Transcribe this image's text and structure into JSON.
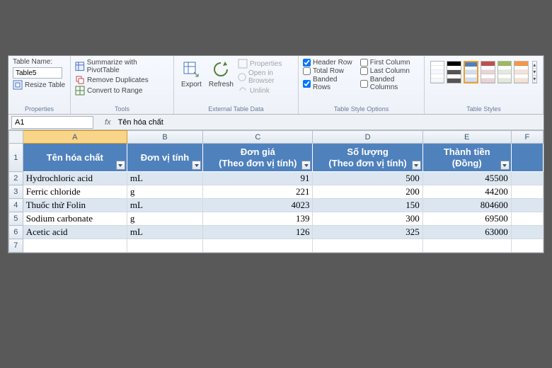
{
  "ribbon": {
    "properties": {
      "table_name_label": "Table Name:",
      "table_name_value": "Table5",
      "resize_label": "Resize Table",
      "group_label": "Properties"
    },
    "tools": {
      "summarize": "Summarize with PivotTable",
      "remove_dup": "Remove Duplicates",
      "convert": "Convert to Range",
      "group_label": "Tools"
    },
    "external": {
      "export": "Export",
      "refresh": "Refresh",
      "props": "Properties",
      "open_browser": "Open in Browser",
      "unlink": "Unlink",
      "group_label": "External Table Data"
    },
    "style_opts": {
      "header_row": "Header Row",
      "total_row": "Total Row",
      "banded_rows": "Banded Rows",
      "first_col": "First Column",
      "last_col": "Last Column",
      "banded_cols": "Banded Columns",
      "group_label": "Table Style Options"
    },
    "table_styles": {
      "group_label": "Table Styles",
      "palette": [
        "#ffffff",
        "#000000",
        "#4f81bd",
        "#c0504d",
        "#9bbb59",
        "#f79646"
      ]
    }
  },
  "formula_bar": {
    "cell_ref": "A1",
    "fx_label": "fx",
    "value": "Tên hóa chất"
  },
  "columns": [
    "A",
    "B",
    "C",
    "D",
    "E",
    "F"
  ],
  "headers": {
    "A": "Tên hóa chất",
    "B": "Đơn vị tính",
    "C": "Đơn giá\n(Theo đơn vị tính)",
    "D": "Số lượng\n(Theo đơn vị tính)",
    "E": "Thành tiền\n(Đồng)"
  },
  "rows": [
    {
      "n": "2",
      "A": "Hydrochloric acid",
      "B": "mL",
      "C": "91",
      "D": "500",
      "E": "45500"
    },
    {
      "n": "3",
      "A": "Ferric chloride",
      "B": "g",
      "C": "221",
      "D": "200",
      "E": "44200"
    },
    {
      "n": "4",
      "A": "Thuốc thử Folin",
      "B": "mL",
      "C": "4023",
      "D": "150",
      "E": "804600"
    },
    {
      "n": "5",
      "A": "Sodium carbonate",
      "B": "g",
      "C": "139",
      "D": "300",
      "E": "69500"
    },
    {
      "n": "6",
      "A": "Acetic acid",
      "B": "mL",
      "C": "126",
      "D": "325",
      "E": "63000"
    },
    {
      "n": "7",
      "A": "",
      "B": "",
      "C": "",
      "D": "",
      "E": ""
    }
  ],
  "col_widths": {
    "A": 148,
    "B": 108,
    "C": 156,
    "D": 156,
    "E": 126,
    "F": 46
  }
}
